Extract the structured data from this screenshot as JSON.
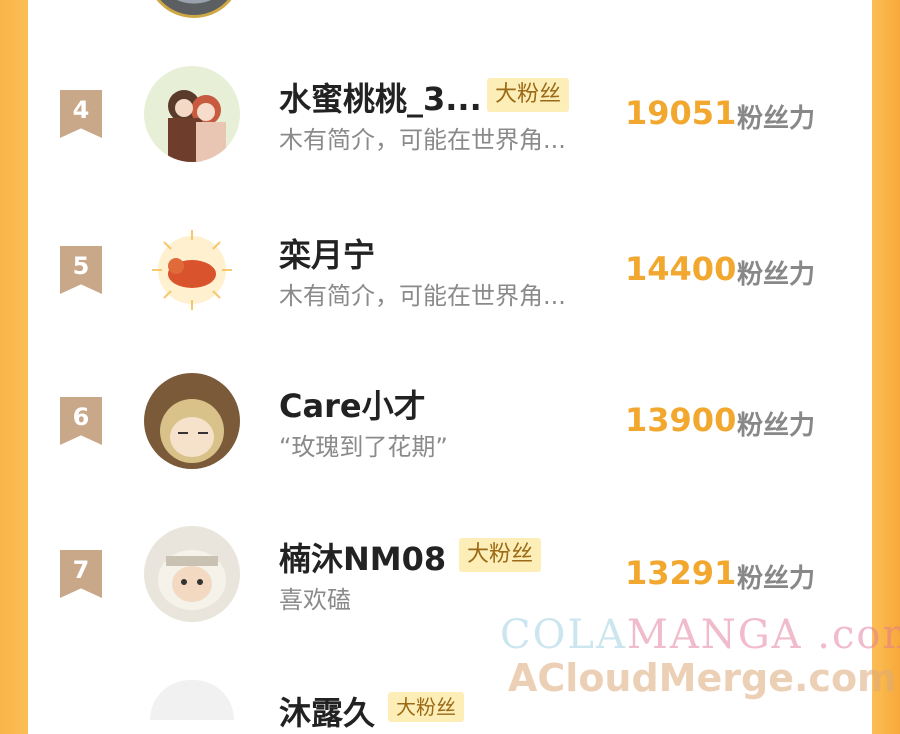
{
  "list": {
    "rows": [
      {
        "rank": "4",
        "name": "水蜜桃桃_3...",
        "badge": "大粉丝",
        "bio": "木有简介，可能在世界角...",
        "score": "19051",
        "unit": "粉丝力"
      },
      {
        "rank": "5",
        "name": "栾月宁",
        "badge": "",
        "bio": "木有简介，可能在世界角...",
        "score": "14400",
        "unit": "粉丝力"
      },
      {
        "rank": "6",
        "name": "Care小才",
        "badge": "",
        "bio": "“玫瑰到了花期”",
        "score": "13900",
        "unit": "粉丝力"
      },
      {
        "rank": "7",
        "name": "楠沐NM08",
        "badge": "大粉丝",
        "bio": "喜欢磕",
        "score": "13291",
        "unit": "粉丝力"
      }
    ],
    "partial_next": {
      "name": "沐露久",
      "badge": "大粉丝"
    }
  },
  "watermark": {
    "line1_a": "COLA",
    "line1_b": "MANGA",
    "line1_c": " .com",
    "line2": "ACloudMerge.com"
  },
  "colors": {
    "accent": "#f2a72e",
    "badge_bg": "#fdeeb8",
    "rank_bg": "#c9a88a",
    "side_orange": "#fbbe55"
  }
}
